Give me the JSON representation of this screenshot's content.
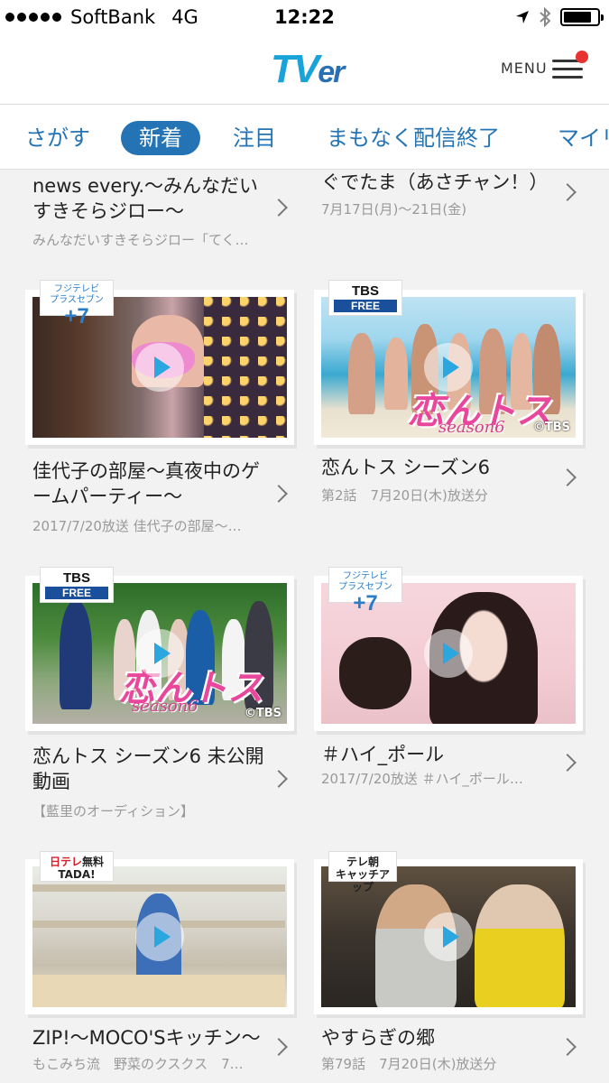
{
  "status_bar": {
    "carrier": "SoftBank",
    "network": "4G",
    "time": "12:22"
  },
  "header": {
    "logo_tv": "TV",
    "logo_er": "er",
    "menu_label": "MENU"
  },
  "tabs": [
    {
      "label": "さがす",
      "active": false
    },
    {
      "label": "新着",
      "active": true
    },
    {
      "label": "注目",
      "active": false
    },
    {
      "label": "まもなく配信終了",
      "active": false
    },
    {
      "label": "マイリ",
      "active": false
    }
  ],
  "cards": [
    {
      "title": "news every.〜みんなだいすきそらジロー〜",
      "title_lines": [
        "news every.〜みんなだい",
        "すきそらジロー〜"
      ],
      "subtitle": "みんなだいすきそらジロー「てく…"
    },
    {
      "title": "ぐでたま（あさチャン！）",
      "subtitle": "7月17日(月)〜21日(金)"
    },
    {
      "title_lines": [
        "佳代子の部屋〜真夜中のゲ",
        "ームパーティー〜"
      ],
      "subtitle": "2017/7/20放送 佳代子の部屋〜…",
      "badge": "フジテレビ プラスセブン +7"
    },
    {
      "title": "恋んトス シーズン6",
      "subtitle": "第2話　7月20日(木)放送分",
      "badge_top": "TBS",
      "badge_bottom": "FREE",
      "copyright": "©TBS",
      "overlay": "恋んトス",
      "overlay_season": "season6"
    },
    {
      "title_lines": [
        "恋んトス シーズン6 未公開",
        "動画"
      ],
      "subtitle": "【藍里のオーディション】",
      "badge_top": "TBS",
      "badge_bottom": "FREE",
      "copyright": "©TBS",
      "overlay": "恋んトス",
      "overlay_season": "season6"
    },
    {
      "title": "＃ハイ_ポール",
      "subtitle": "2017/7/20放送 ＃ハイ_ポール…",
      "badge": "フジテレビ プラスセブン +7"
    },
    {
      "title": "ZIP!〜MOCO'Sキッチン〜",
      "subtitle": "もこみち流　野菜のクスクス　7…",
      "badge": "日テレ無料TADA!"
    },
    {
      "title": "やすらぎの郷",
      "subtitle": "第79話　7月20日(木)放送分",
      "badge": "テレ朝キャッチアップ"
    }
  ],
  "colors": {
    "accent": "#2474b5",
    "play": "#2ba7df",
    "notification": "#e8322f"
  }
}
